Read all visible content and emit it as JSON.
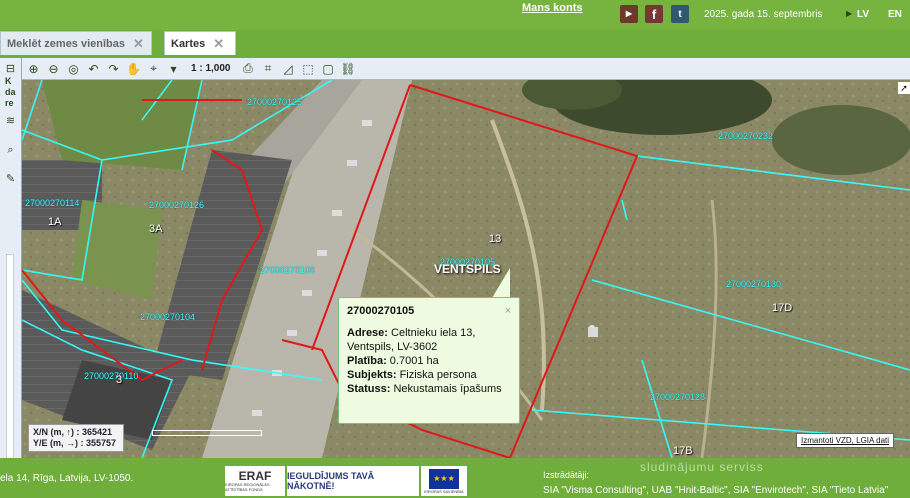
{
  "header": {
    "account_link": "Mans konts",
    "social": {
      "youtube": "You Tube",
      "facebook": "f",
      "twitter": "t"
    },
    "date": "2025. gada 15. septembris",
    "languages": [
      "LV",
      "EN"
    ]
  },
  "tabs": [
    {
      "label": "Meklēt zemes vienības",
      "close": "✕"
    },
    {
      "label": "Kartes",
      "close": "✕"
    }
  ],
  "toolbar": {
    "scale": "1 : 1,000",
    "icons": [
      "zoom-in",
      "zoom-out",
      "zoom-extent",
      "back",
      "forward",
      "pan",
      "identify",
      "dropdown",
      "print",
      "measure-area",
      "measure-angle",
      "select",
      "comment",
      "link"
    ]
  },
  "sidebar": {
    "text": [
      "K",
      "da",
      "re"
    ]
  },
  "map": {
    "parcel_labels": [
      "27000270125",
      "27000270232",
      "27000270114",
      "27000270126",
      "27000270106",
      "27000270130",
      "27000270104",
      "27000270110",
      "27000270128",
      "27000270105"
    ],
    "address_labels": [
      "1A",
      "3A",
      "13",
      "3",
      "17D",
      "17B"
    ],
    "city": "VENTSPILS",
    "popup": {
      "title": "27000270105",
      "close": "×",
      "adrese_label": "Adrese:",
      "adrese_value": "Celtnieku iela 13, Ventspils, LV-3602",
      "platiba_label": "Platība:",
      "platiba_value": "0.7001 ha",
      "subjekts_label": "Subjekts:",
      "subjekts_value": "Fiziska persona",
      "statuss_label": "Statuss:",
      "statuss_value": "Nekustamais īpašums"
    },
    "coords": {
      "xn_label": "X/N (m, ↑) :",
      "xn_value": "365421",
      "ye_label": "Y/E (m, →) :",
      "ye_value": "355757"
    },
    "attribution": "Izmantoti VZD, LGIA dati"
  },
  "footer": {
    "address": "ela 14, Rīga, Latvija, LV-1050.",
    "eraf": "ERAF",
    "eraf_sub": "EIROPAS REĢIONĀLĀS ATTĪSTĪBAS FONDS",
    "investment": "IEGULDĪJUMS TAVĀ NĀKOTNĒ!",
    "eu_sub": "EIROPAS SAVIENĪBA",
    "developers_label": "Izstrādātāji:",
    "developers": "SIA \"Visma Consulting\", UAB \"Hnit-Baltic\", SIA \"Envirotech\", SIA \"Tieto Latvia\"",
    "watermark": "sludinājumu serviss"
  },
  "colors": {
    "brand_green": "#76b33f",
    "parcel_border_cyan": "#33ffff",
    "selected_border_red": "#e01818"
  }
}
